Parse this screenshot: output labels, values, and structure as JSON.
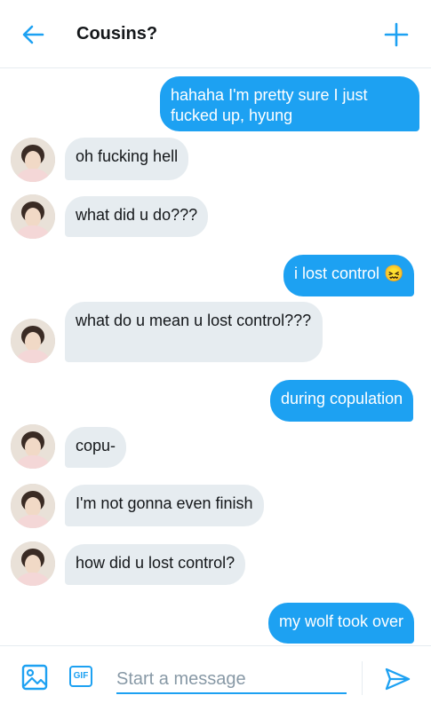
{
  "header": {
    "title": "Cousins?",
    "back_icon": "back-arrow-icon",
    "new_icon": "plus-icon",
    "accent": "#1da1f2"
  },
  "messages": [
    {
      "direction": "outgoing",
      "text": "hahaha I'm pretty sure I just fucked up, hyung"
    },
    {
      "direction": "incoming",
      "text": "oh fucking hell"
    },
    {
      "direction": "incoming",
      "text": "what did u do???"
    },
    {
      "direction": "outgoing",
      "text": "i lost control 😖"
    },
    {
      "direction": "incoming",
      "text": "what do u mean u lost control???"
    },
    {
      "direction": "outgoing",
      "text": "during copulation"
    },
    {
      "direction": "incoming",
      "text": "copu-"
    },
    {
      "direction": "incoming",
      "text": "I'm not gonna even finish"
    },
    {
      "direction": "incoming",
      "text": "how did u lost control?"
    },
    {
      "direction": "outgoing",
      "text": "my wolf took over"
    }
  ],
  "composer": {
    "placeholder": "Start a message",
    "gif_label": "GIF",
    "image_icon": "image-icon",
    "send_icon": "send-icon"
  },
  "colors": {
    "outgoing_bubble": "#1da1f2",
    "incoming_bubble": "#e6ecf0"
  }
}
